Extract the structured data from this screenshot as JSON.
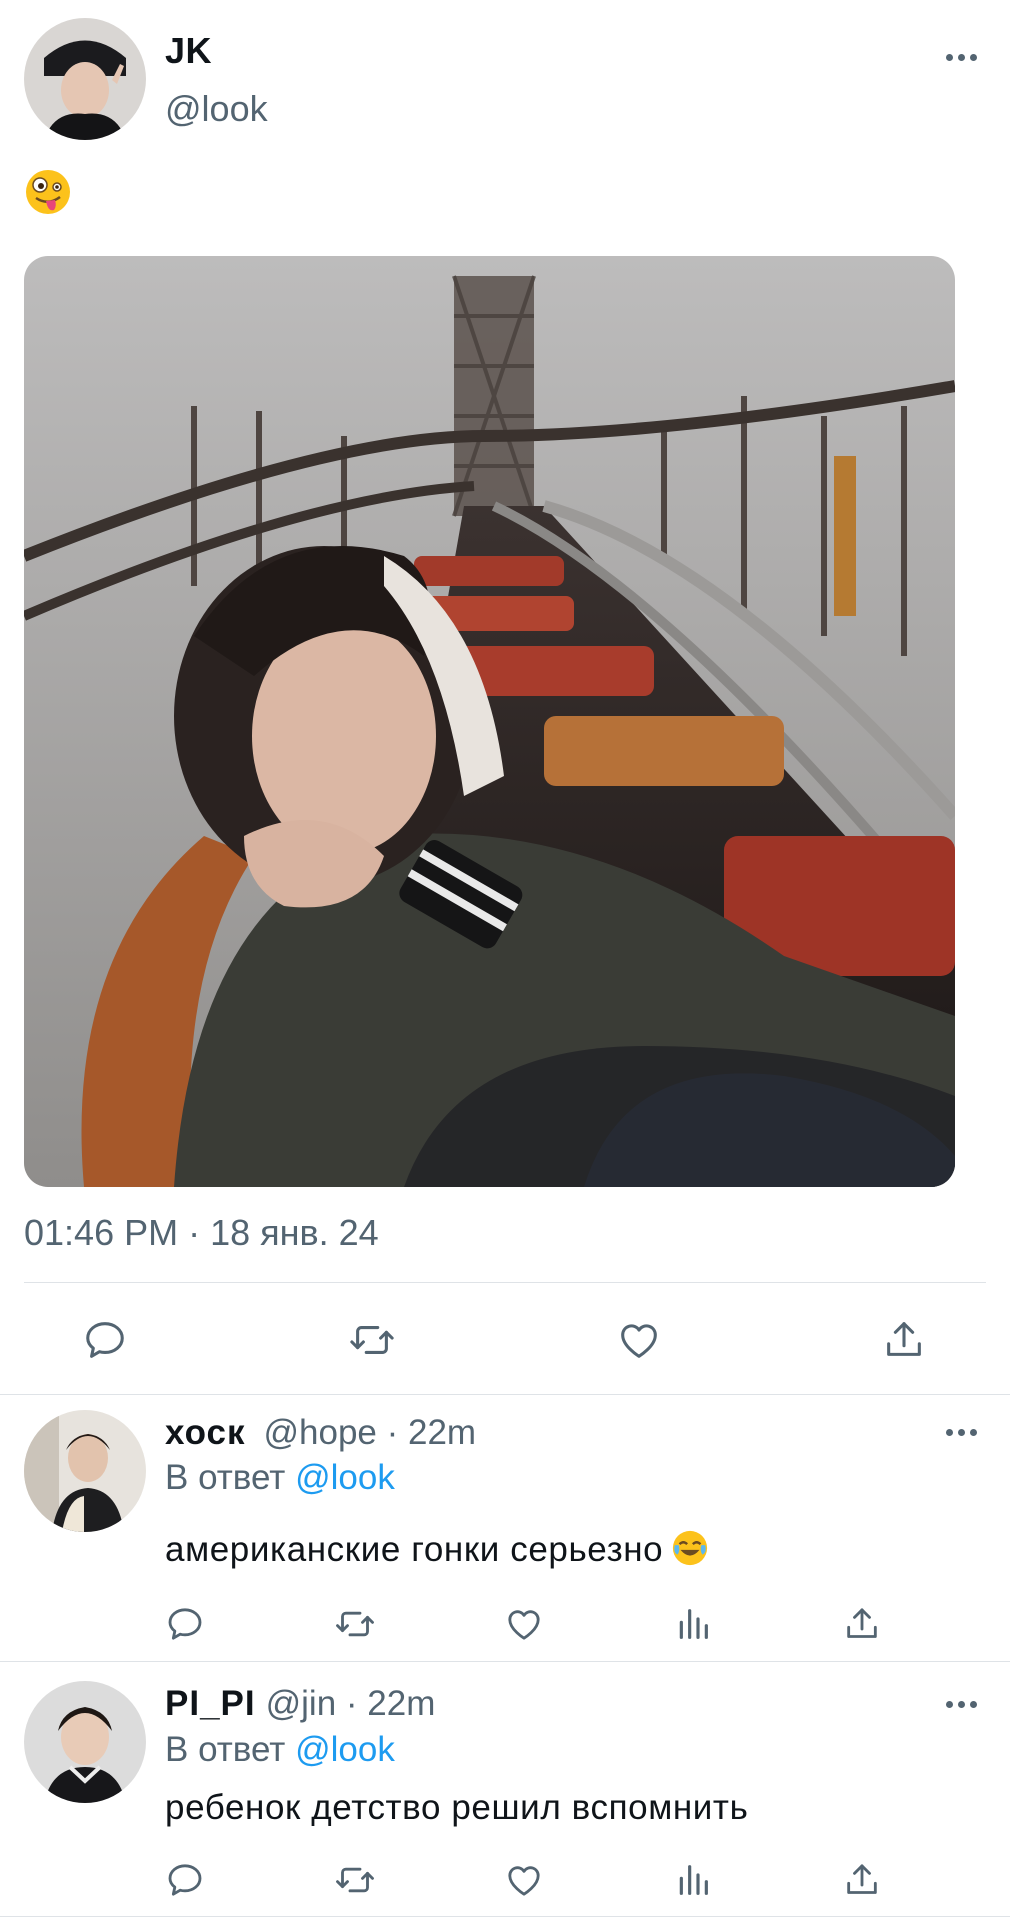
{
  "tweet": {
    "author_name": "JK",
    "author_handle": "@look",
    "text_emoji": "zany-face-emoji",
    "timestamp": "01:46 PM · 18 янв. 24"
  },
  "replies": [
    {
      "name": "хоск",
      "handle_time": "@hope · 22m",
      "in_reply_prefix": "В ответ",
      "in_reply_mention": "@look",
      "text": "американские гонки серьезно",
      "text_emoji": "tears-of-joy-emoji"
    },
    {
      "name": "PI_PI",
      "handle_time": "@jin · 22m",
      "in_reply_prefix": "В ответ",
      "in_reply_mention": "@look",
      "text": "ребенок детство решил вспомнить"
    }
  ],
  "icons": {
    "reply": "reply-icon",
    "retweet": "retweet-icon",
    "like": "heart-icon",
    "views": "views-icon",
    "share": "share-icon",
    "more": "more-icon"
  },
  "colors": {
    "text": "#0f1419",
    "secondary": "#536471",
    "mention": "#1d9bf0",
    "divider": "#dfe3e7"
  }
}
